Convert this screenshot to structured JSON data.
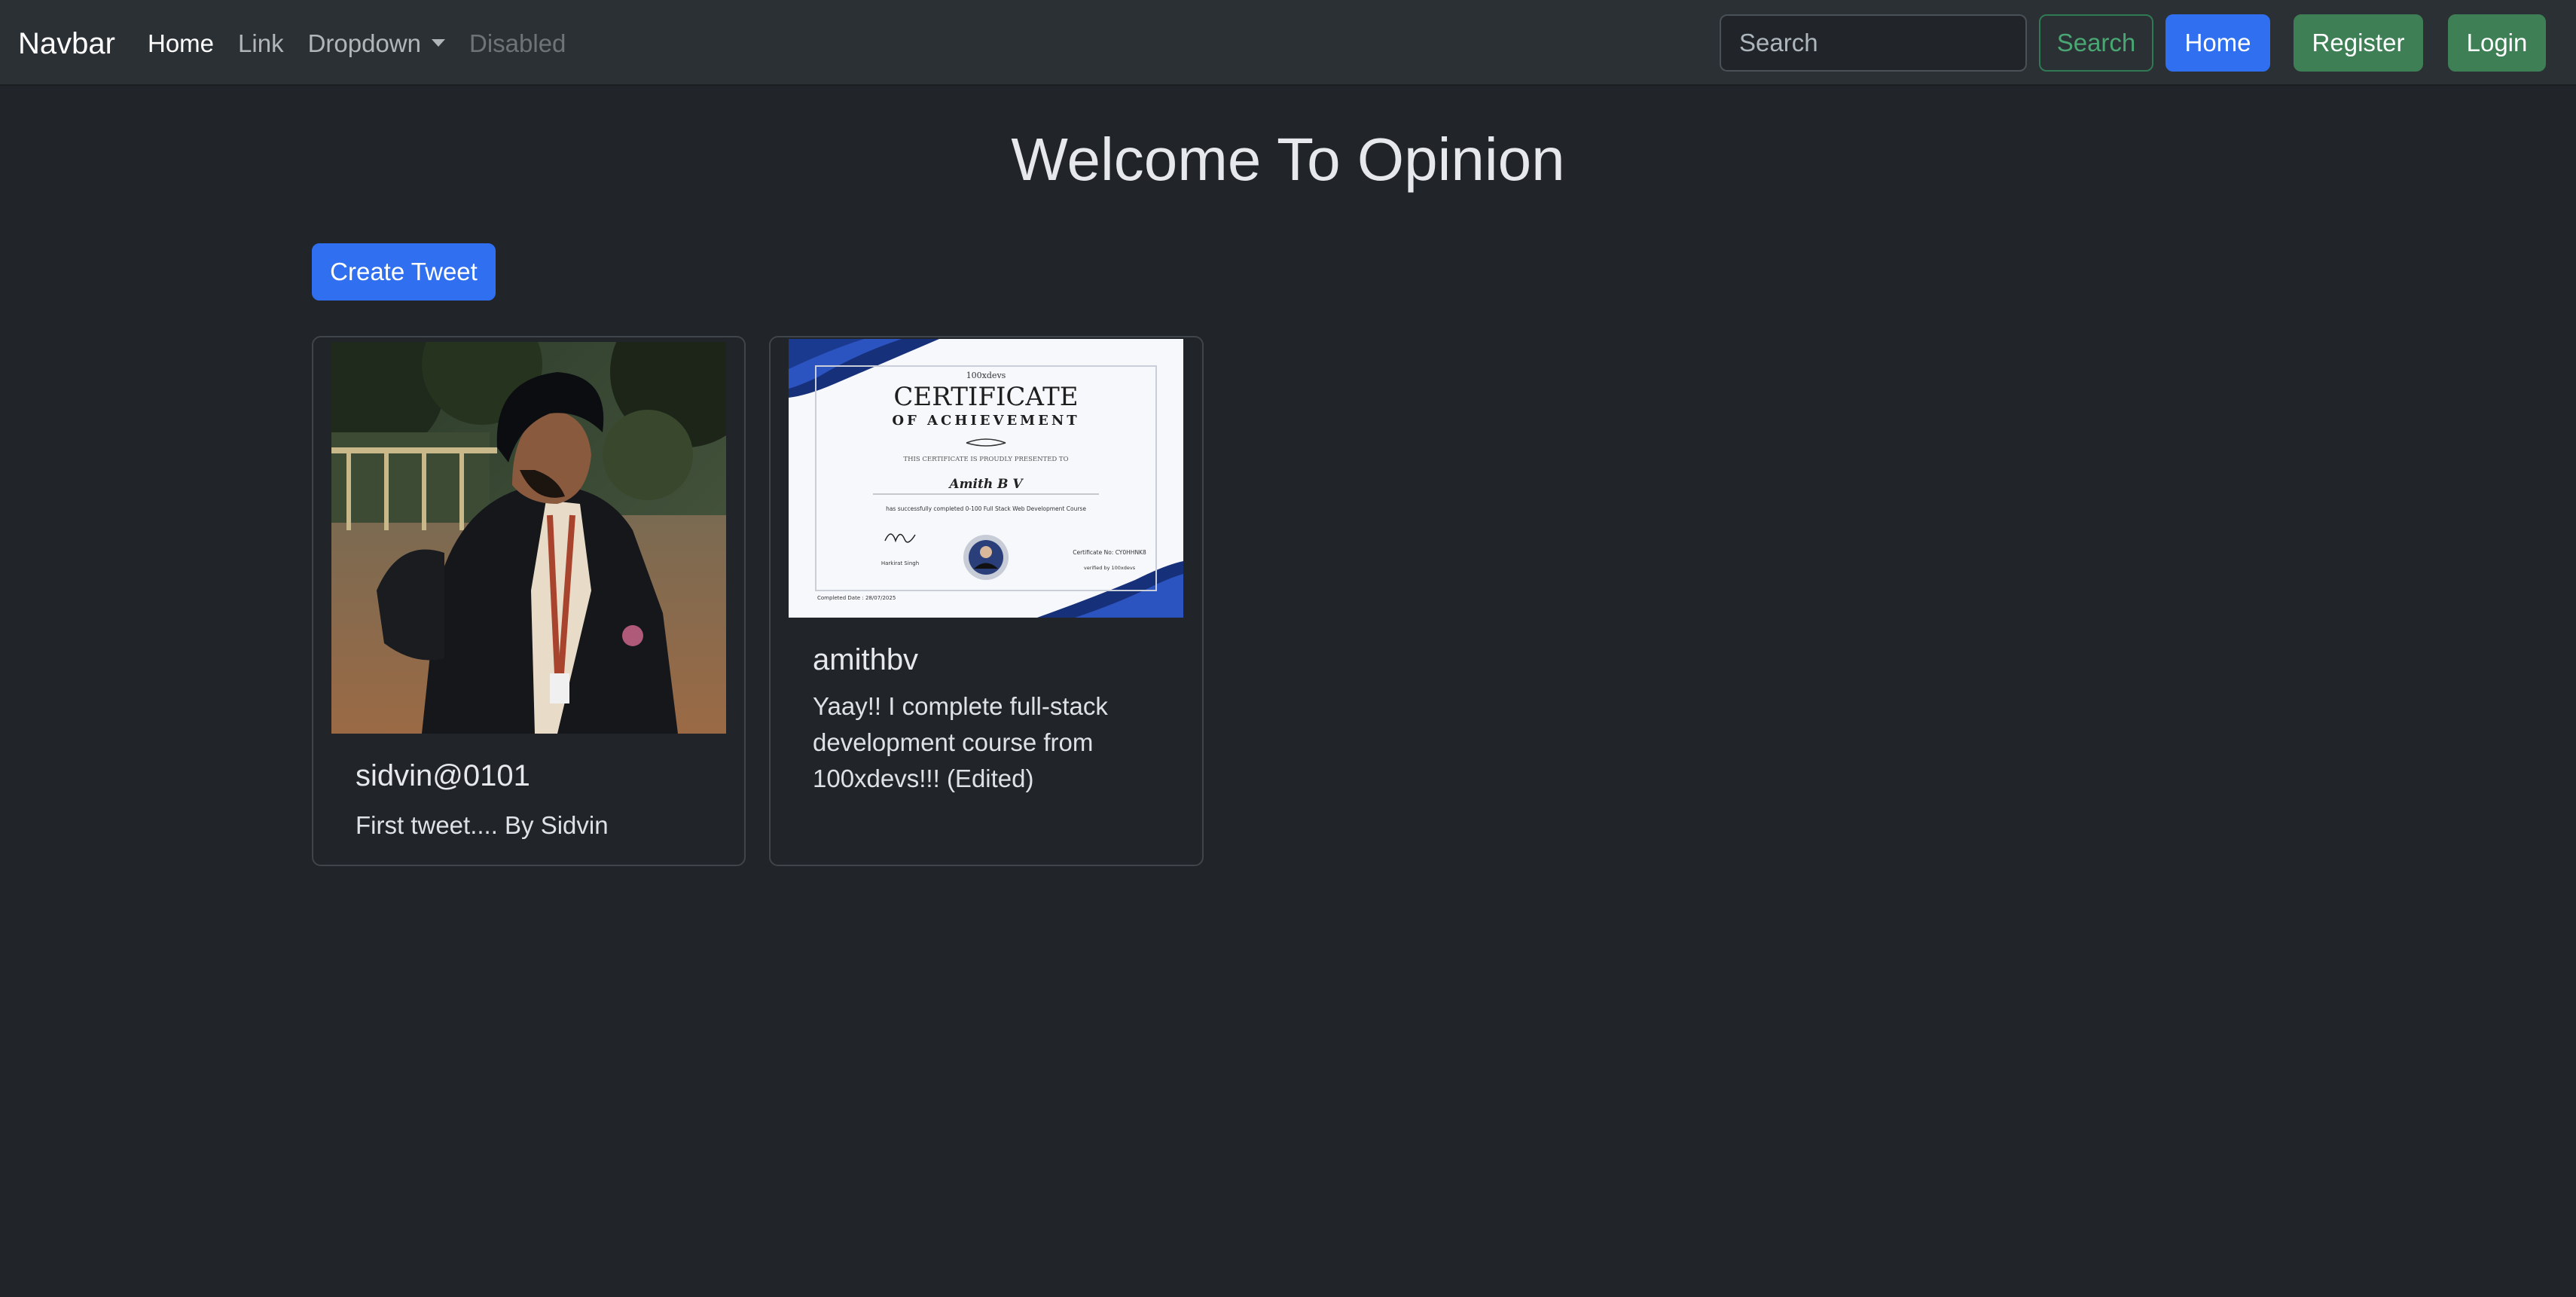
{
  "navbar": {
    "brand": "Navbar",
    "links": {
      "home": "Home",
      "link": "Link",
      "dropdown": "Dropdown",
      "disabled": "Disabled"
    },
    "search_placeholder": "Search",
    "search_button": "Search",
    "home_button": "Home",
    "register_button": "Register",
    "login_button": "Login"
  },
  "main": {
    "title": "Welcome To Opinion",
    "create_button": "Create Tweet",
    "tweets": [
      {
        "username": "sidvin@0101",
        "text": "First tweet.... By Sidvin",
        "image": "person photo"
      },
      {
        "username": "amithbv",
        "text": "Yaay!! I complete full-stack development course from 100xdevs!!! (Edited)",
        "image": "certificate of achievement",
        "certificate": {
          "org": "100xdevs",
          "heading": "CERTIFICATE",
          "subheading": "OF ACHIEVEMENT",
          "presented": "THIS CERTIFICATE IS PROUDLY PRESENTED TO",
          "name": "Amith B V",
          "course_line": "has successfully completed 0-100 Full Stack Web Development Course",
          "signer": "Harkirat Singh",
          "cert_no": "Certificate No: CY0HHNK8",
          "verified": "verified by 100xdevs",
          "completed": "Completed Date : 28/07/2025"
        }
      }
    ]
  },
  "colors": {
    "background": "#212529",
    "navbar": "#2b3035",
    "primary": "#2f6ff0",
    "success": "#3e7f55"
  }
}
